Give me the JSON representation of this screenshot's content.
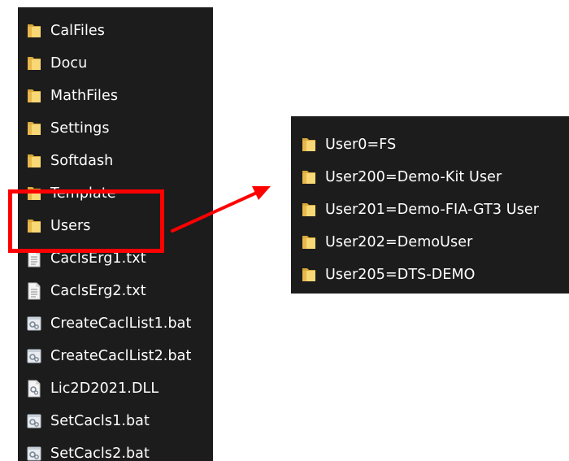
{
  "left_list": {
    "items": [
      {
        "label": "CalFiles",
        "icon": "folder-icon"
      },
      {
        "label": "Docu",
        "icon": "folder-icon"
      },
      {
        "label": "MathFiles",
        "icon": "folder-icon"
      },
      {
        "label": "Settings",
        "icon": "folder-icon"
      },
      {
        "label": "Softdash",
        "icon": "folder-icon"
      },
      {
        "label": "Template",
        "icon": "folder-icon"
      },
      {
        "label": "Users",
        "icon": "folder-icon"
      },
      {
        "label": "CaclsErg1.txt",
        "icon": "text-file-icon"
      },
      {
        "label": "CaclsErg2.txt",
        "icon": "text-file-icon"
      },
      {
        "label": "CreateCaclList1.bat",
        "icon": "batch-file-icon"
      },
      {
        "label": "CreateCaclList2.bat",
        "icon": "batch-file-icon"
      },
      {
        "label": "Lic2D2021.DLL",
        "icon": "dll-file-icon"
      },
      {
        "label": "SetCacls1.bat",
        "icon": "batch-file-icon"
      },
      {
        "label": "SetCacls2.bat",
        "icon": "batch-file-icon"
      }
    ]
  },
  "right_list": {
    "items": [
      {
        "label": "User0=FS",
        "icon": "folder-icon"
      },
      {
        "label": "User200=Demo-Kit User",
        "icon": "folder-icon"
      },
      {
        "label": "User201=Demo-FIA-GT3 User",
        "icon": "folder-icon"
      },
      {
        "label": "User202=DemoUser",
        "icon": "folder-icon"
      },
      {
        "label": "User205=DTS-DEMO",
        "icon": "folder-icon"
      }
    ]
  },
  "colors": {
    "panel_background": "#1c1c1c",
    "folder": "#f8d775",
    "highlight": "#ff0000",
    "arrow": "#ff0000",
    "text": "#ffffff"
  }
}
